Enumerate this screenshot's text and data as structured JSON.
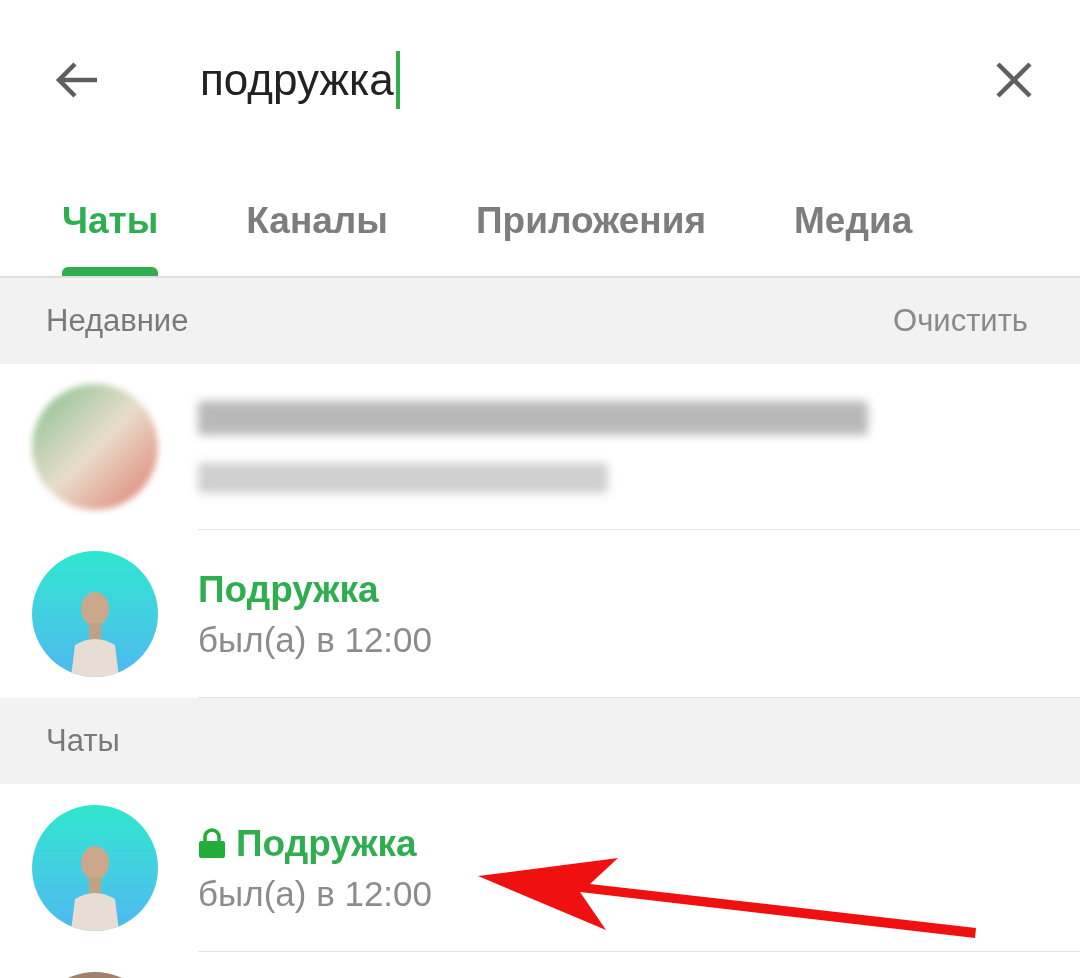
{
  "search": {
    "value": "подружка"
  },
  "tabs": [
    {
      "label": "Чаты",
      "selected": true
    },
    {
      "label": "Каналы",
      "selected": false
    },
    {
      "label": "Приложения",
      "selected": false
    },
    {
      "label": "Медиа",
      "selected": false
    }
  ],
  "sections": [
    {
      "title": "Недавние",
      "action": "Очистить",
      "items": [
        {
          "kind": "blurred"
        },
        {
          "kind": "contact",
          "name": "Подружка",
          "status": "был(а) в 12:00",
          "secret": false
        }
      ]
    },
    {
      "title": "Чаты",
      "items": [
        {
          "kind": "contact",
          "name": "Подружка",
          "status": "был(а) в 12:00",
          "secret": true
        },
        {
          "kind": "partial"
        }
      ]
    }
  ]
}
